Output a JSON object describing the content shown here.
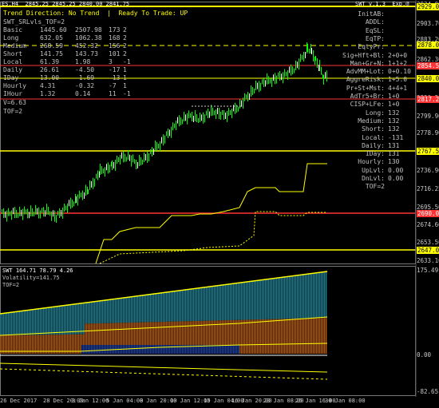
{
  "title_bar": {
    "symbol_line": "ES,H4  2845.25 2845.25 2840.00 2841.75",
    "top_right_text": "SWT v.1.3  Exp.@"
  },
  "status": {
    "trend_text": "Trend Direction: No Trend  |  Ready To Trade: UP",
    "indicator_name": "SWT_SRLvls_TOF=2"
  },
  "stats_table": {
    "rows": [
      {
        "label": "Basic",
        "a": "1445.60",
        "b": "2507.98",
        "c": "173",
        "d": "2"
      },
      {
        "label": "Long",
        "a": "632.05",
        "b": "1062.38",
        "c": "168",
        "d": "2"
      },
      {
        "label": "Medium",
        "a": "268.59",
        "b": "452.32",
        "c": "156",
        "d": "2"
      },
      {
        "label": "Short",
        "a": "141.75",
        "b": "143.73",
        "c": "101",
        "d": "2"
      },
      {
        "label": "Local",
        "a": "61.39",
        "b": "1.98",
        "c": "3",
        "d": "-1"
      },
      {
        "label": "Daily",
        "a": "26.61",
        "b": "-4.50",
        "c": "-17",
        "d": "1"
      },
      {
        "label": "IDay",
        "a": "13.00",
        "b": "-1.69",
        "c": "-13",
        "d": "1"
      },
      {
        "label": "Hourly",
        "a": "4.31",
        "b": "-0.32",
        "c": "-7",
        "d": "1"
      },
      {
        "label": "IHour",
        "a": "1.32",
        "b": "0.14",
        "c": "11",
        "d": "-1"
      }
    ],
    "v_line": "V=6.63",
    "tof_line": "TOF=2"
  },
  "right_panel": {
    "rows": [
      {
        "label": "InitAB:",
        "value": ""
      },
      {
        "label": "ADDL:",
        "value": ""
      },
      {
        "label": "EqSL:",
        "value": ""
      },
      {
        "label": "EqTP:",
        "value": ""
      },
      {
        "label": "EqtyPr:",
        "value": ""
      },
      {
        "label": "Sig+Hft+Bl:",
        "value": "2+0+0"
      },
      {
        "label": "Man+Gr+N:",
        "value": "1+1+2"
      },
      {
        "label": "AdvMM+Lot:",
        "value": "0+0.10"
      },
      {
        "label": "AggreRisk:",
        "value": "1+5.0"
      },
      {
        "label": "Pr+St+Mst:",
        "value": "4+4+1"
      },
      {
        "label": "AdTr5+Br:",
        "value": "1+0"
      },
      {
        "label": "CISP+LFe:",
        "value": "1+0"
      },
      {
        "label": "Long:",
        "value": "132"
      },
      {
        "label": "Medium:",
        "value": "132"
      },
      {
        "label": "Short:",
        "value": "132"
      },
      {
        "label": "Local:",
        "value": "-131"
      },
      {
        "label": "Daily:",
        "value": "131"
      },
      {
        "label": "IDay:",
        "value": "131"
      },
      {
        "label": "Hourly:",
        "value": "130"
      },
      {
        "label": "UpLvl:",
        "value": "0.00"
      },
      {
        "label": "DnLvl:",
        "value": "0.00"
      },
      {
        "label": "TOF=2",
        "value": ""
      }
    ]
  },
  "price_axis": {
    "labels": [
      "2924.00",
      "2903.70",
      "2883.20",
      "2862.30",
      "2841.75",
      "2820.20",
      "2799.90",
      "2778.90",
      "2757.50",
      "2736.90",
      "2716.25",
      "2695.50",
      "2674.60",
      "2653.50",
      "2633.10"
    ],
    "boxes": [
      {
        "text": "2929.00",
        "color": "#ffff00",
        "fg": "#000"
      },
      {
        "text": "2878.00",
        "color": "#ffff00",
        "fg": "#000"
      },
      {
        "text": "2854.50",
        "color": "#ff3333",
        "fg": "#fff"
      },
      {
        "text": "2840.00",
        "color": "#ffff00",
        "fg": "#000"
      },
      {
        "text": "2817.25",
        "color": "#ff3333",
        "fg": "#fff"
      },
      {
        "text": "2767.50",
        "color": "#ffff00",
        "fg": "#000"
      },
      {
        "text": "2690.00",
        "color": "#ff3333",
        "fg": "#fff"
      },
      {
        "text": "2647.00",
        "color": "#ffff00",
        "fg": "#000"
      }
    ]
  },
  "sub_panel": {
    "header": "SWT 164.71 78.79 4.26",
    "volatility": "Volatility=141.75",
    "tof": "TOF=2",
    "axis_top": "175.49",
    "axis_zero": "0.00",
    "axis_bottom": "-82.65"
  },
  "time_axis": {
    "labels": [
      "26 Dec 2017",
      "28 Dec 20:00",
      "3 Jan 12:00",
      "5 Jan 04:00",
      "8 Jan 20:00",
      "10 Jan 12:00",
      "15 Jan 04:00",
      "16 Jan 20:00",
      "23 Jan 08:00",
      "25 Jan 16:00",
      "30 Jan 08:00"
    ]
  },
  "colors": {
    "up_candle": "#00ff00",
    "level_yellow": "#ffff00",
    "level_red": "#ff3333",
    "histogram_cyan": "#1e7f92",
    "histogram_orange": "#b05a0a",
    "histogram_blue": "#1f3f9c"
  }
}
